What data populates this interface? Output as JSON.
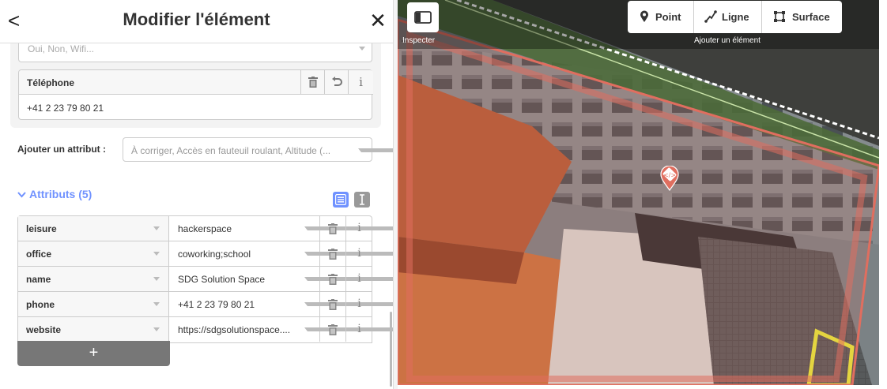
{
  "sidebar": {
    "header": {
      "back_glyph": "<",
      "title": "Modifier l'élément",
      "close_glyph": "✕"
    },
    "previous_field": {
      "placeholder": "Oui, Non, Wifi..."
    },
    "phone_field": {
      "label": "Téléphone",
      "value": "+41 2 23 79 80 21",
      "info_glyph": "i"
    },
    "add_attribute": {
      "label": "Ajouter un attribut :",
      "placeholder": "À corriger, Accès en fauteuil roulant, Altitude (..."
    },
    "tags_section": {
      "title": "Attributs (5)",
      "rows": [
        {
          "key": "leisure",
          "value": "hackerspace"
        },
        {
          "key": "office",
          "value": "coworking;school"
        },
        {
          "key": "name",
          "value": "SDG Solution Space"
        },
        {
          "key": "phone",
          "value": "+41 2 23 79 80 21"
        },
        {
          "key": "website",
          "value": "https://sdgsolutionspace...."
        }
      ],
      "info_glyph": "i",
      "add_glyph": "+"
    }
  },
  "map_toolbar": {
    "inspect_label": "Inspecter",
    "modes": [
      {
        "label": "Point",
        "icon": "point-pin-icon"
      },
      {
        "label": "Ligne",
        "icon": "line-icon"
      },
      {
        "label": "Surface",
        "icon": "area-icon"
      }
    ],
    "add_label": "Ajouter un élément"
  },
  "colors": {
    "accent": "#7092ff",
    "area_outline": "#e06e5f",
    "marker": "#e06e5f"
  }
}
